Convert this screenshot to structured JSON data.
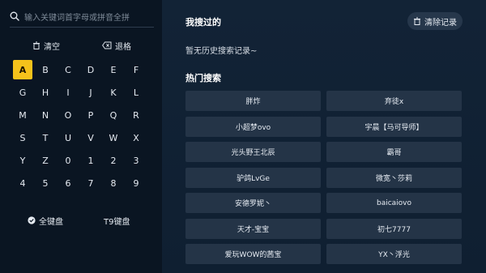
{
  "search": {
    "placeholder": "输入关键词首字母或拼音全拼"
  },
  "actions": {
    "clear_label": "清空",
    "backspace_label": "退格"
  },
  "keyboard": {
    "active_key": "A",
    "keys": [
      "A",
      "B",
      "C",
      "D",
      "E",
      "F",
      "G",
      "H",
      "I",
      "J",
      "K",
      "L",
      "M",
      "N",
      "O",
      "P",
      "Q",
      "R",
      "S",
      "T",
      "U",
      "V",
      "W",
      "X",
      "Y",
      "Z",
      "0",
      "1",
      "2",
      "3",
      "4",
      "5",
      "6",
      "7",
      "8",
      "9"
    ]
  },
  "keyboard_modes": {
    "full": "全键盘",
    "t9": "T9键盘",
    "selected": "全键盘"
  },
  "history": {
    "title": "我搜过的",
    "clear_button": "清除记录",
    "empty_text": "暂无历史搜索记录~"
  },
  "hot": {
    "title": "热门搜索",
    "items": [
      "胖炸",
      "弃徒x",
      "小超梦ovo",
      "宇晨【马可导师】",
      "光头野王北辰",
      "霸哥",
      "驴鸽LvGe",
      "微宽丶莎莉",
      "安德罗妮丶",
      "baicaiovo",
      "天才-宝宝",
      "初七7777",
      "爱玩WOW的茜宝",
      "YX丶浮光"
    ]
  },
  "colors": {
    "left_bg": "#0a1522",
    "right_bg": "#122336",
    "active_key": "#f5c21b",
    "item_bg": "#243447"
  }
}
